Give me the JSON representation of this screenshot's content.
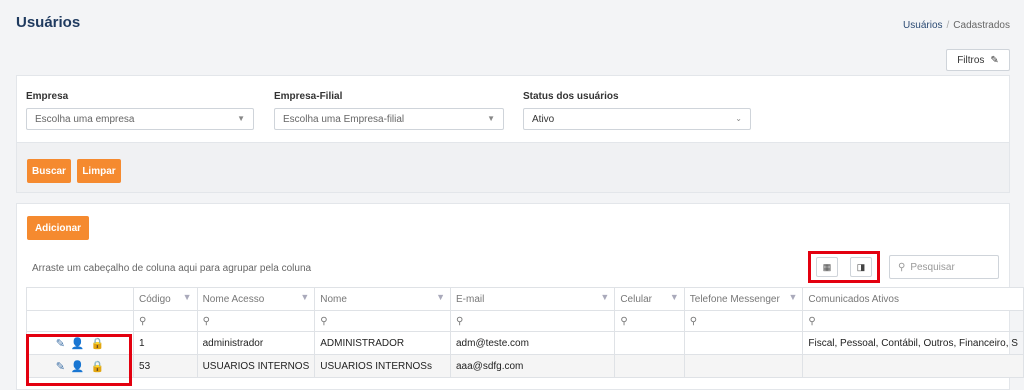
{
  "page": {
    "title": "Usuários"
  },
  "breadcrumb": {
    "current": "Usuários",
    "separator": "/",
    "parent": "Cadastrados"
  },
  "filter_toggle": {
    "label": "Filtros",
    "icon": "pin-icon"
  },
  "filters": {
    "empresa": {
      "label": "Empresa",
      "placeholder": "Escolha uma empresa"
    },
    "empresa_filial": {
      "label": "Empresa-Filial",
      "placeholder": "Escolha uma Empresa-filial"
    },
    "status": {
      "label": "Status dos usuários",
      "value": "Ativo"
    }
  },
  "actions": {
    "search_label": "Buscar",
    "clear_label": "Limpar",
    "add_label": "Adicionar"
  },
  "grid": {
    "group_hint": "Arraste um cabeçalho de coluna aqui para agrupar pela coluna",
    "search_placeholder": "Pesquisar",
    "columns": [
      "Código",
      "Nome Acesso",
      "Nome",
      "E-mail",
      "Celular",
      "Telefone Messenger",
      "Comunicados Ativos"
    ],
    "rows": [
      {
        "codigo": "1",
        "nome_acesso": "administrador",
        "nome": "ADMINISTRADOR",
        "email": "adm@teste.com",
        "celular": "",
        "telefone": "",
        "comunicados": "Fiscal, Pessoal, Contábil, Outros, Financeiro, S"
      },
      {
        "codigo": "53",
        "nome_acesso": "USUARIOS INTERNOS",
        "nome": "USUARIOS INTERNOSs",
        "email": "aaa@sdfg.com",
        "celular": "",
        "telefone": "",
        "comunicados": ""
      }
    ]
  },
  "colors": {
    "accent": "#f58a2f",
    "title": "#1f3a5f",
    "highlight": "#e3000f",
    "row_icon": "#3b6ea5"
  }
}
